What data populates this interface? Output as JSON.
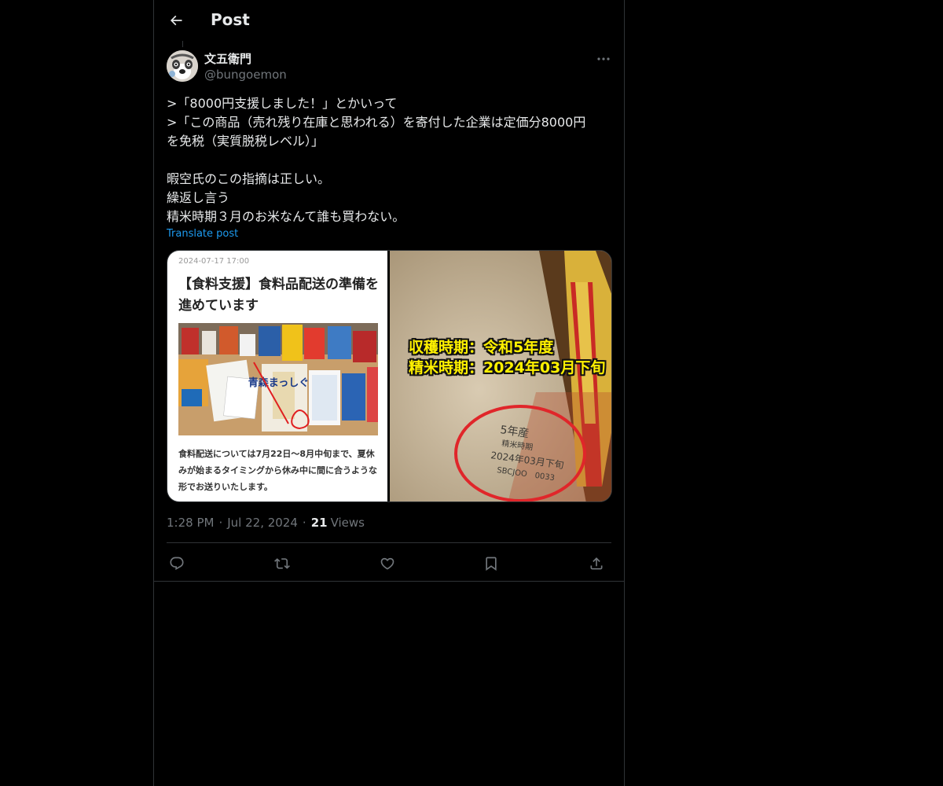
{
  "header": {
    "title": "Post",
    "back_icon": "arrow-left-icon"
  },
  "author": {
    "name": "文五衛門",
    "handle": "@bungoemon",
    "avatar_icon": "cartoon-avatar"
  },
  "post": {
    "lines": [
      ">「8000円支援しました！」とかいって",
      ">「この商品（売れ残り在庫と思われる）を寄付した企業は定価分8000円",
      "を免税（実質脱税レベル）」",
      "",
      "暇空氏のこの指摘は正しい。",
      "繰返し言う",
      "精米時期３月のお米なんて誰も買わない。"
    ],
    "translate_label": "Translate post"
  },
  "media": {
    "left": {
      "date": "2024-07-17 17:00",
      "title": "【食料支援】食料品配送の準備を進めています",
      "caption": "食料配送については7月22日～8月中旬まで、夏休みが始まるタイミングから休み中に間に合うような形でお送りいたします。",
      "bag_label": "青森まっしぐら"
    },
    "right": {
      "harvest": "収穫時期：令和5年度",
      "milling": "精米時期：2024年03月下旬",
      "stamp_line1": "5年産",
      "stamp_line2": "精米時期",
      "stamp_line3": "2024年03月下旬",
      "stamp_line4": "SBCJOO　0033"
    }
  },
  "meta": {
    "time": "1:28 PM",
    "separator": "·",
    "date": "Jul 22, 2024",
    "views_count": "21",
    "views_label": "Views"
  },
  "actions": [
    "reply-icon",
    "repost-icon",
    "like-icon",
    "bookmark-icon",
    "share-icon"
  ],
  "colors": {
    "background": "#000000",
    "text": "#e7e9ea",
    "secondary": "#71767b",
    "link": "#1d9bf0",
    "border": "#2f3336",
    "overlay_text": "#fff100"
  }
}
